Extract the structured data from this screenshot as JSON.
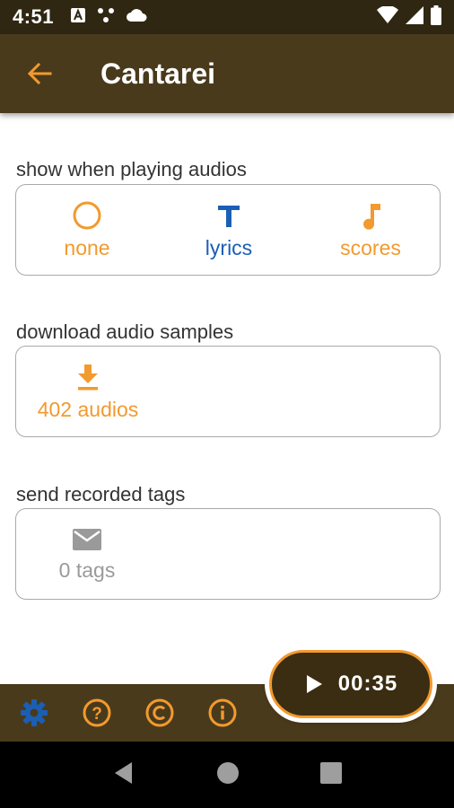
{
  "status_bar": {
    "time": "4:51"
  },
  "app_bar": {
    "title": "Cantarei"
  },
  "playback_section": {
    "label": "show when playing audios",
    "options": [
      {
        "label": "none",
        "icon": "circle-outline-icon",
        "color": "#f29a2e"
      },
      {
        "label": "lyrics",
        "icon": "text-icon",
        "color": "#1a5fb4",
        "selected": true
      },
      {
        "label": "scores",
        "icon": "music-note-icon",
        "color": "#f29a2e"
      }
    ]
  },
  "download_section": {
    "label": "download audio samples",
    "button_label": "402 audios",
    "icon": "download-icon"
  },
  "tags_section": {
    "label": "send recorded tags",
    "button_label": "0 tags",
    "icon": "mail-icon"
  },
  "player": {
    "time": "00:35",
    "icon": "play-icon"
  },
  "bottom_bar": {
    "items": [
      {
        "icon": "settings-icon",
        "active": true
      },
      {
        "icon": "help-icon"
      },
      {
        "icon": "copyright-icon"
      },
      {
        "icon": "info-icon"
      }
    ]
  },
  "colors": {
    "accent": "#f29a2e",
    "primary": "#4a3a1c",
    "selected": "#1a5fb4"
  }
}
